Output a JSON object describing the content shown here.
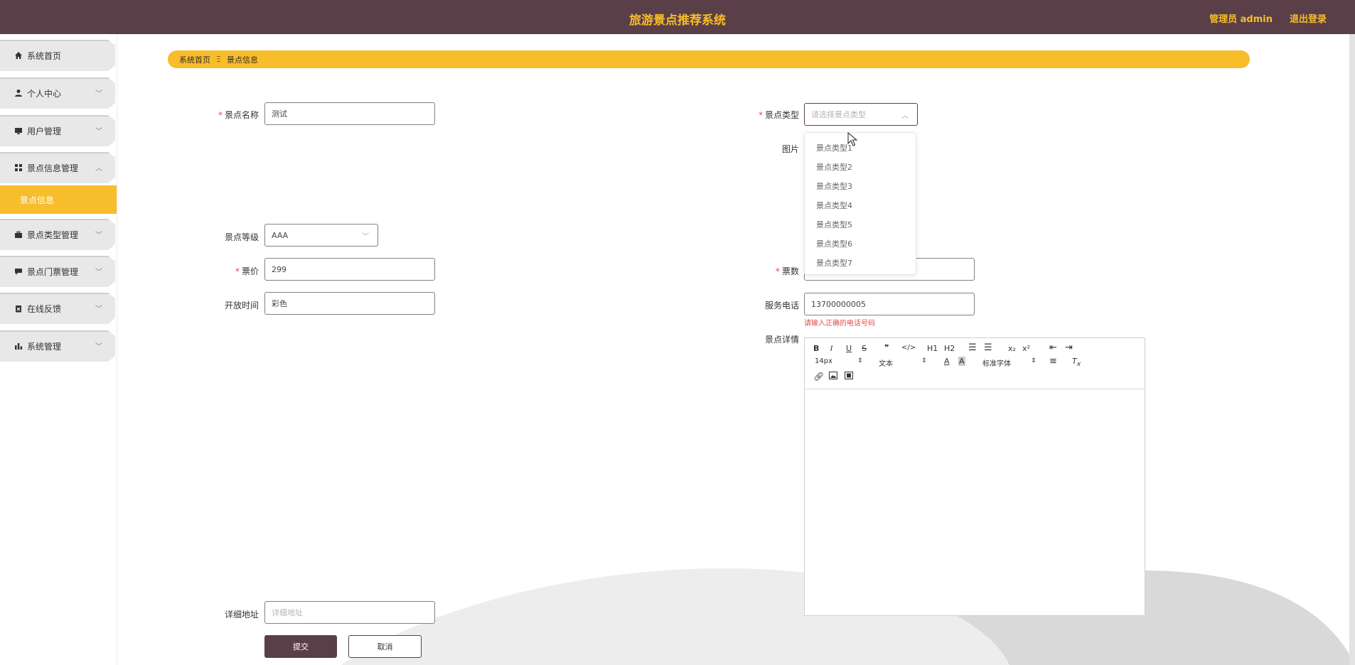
{
  "header": {
    "title": "旅游景点推荐系统",
    "user_label": "管理员 admin",
    "logout_label": "退出登录"
  },
  "sidebar": {
    "items": [
      {
        "label": "系统首页",
        "icon": "home-icon"
      },
      {
        "label": "个人中心",
        "icon": "person-icon"
      },
      {
        "label": "用户管理",
        "icon": "monitor-icon"
      },
      {
        "label": "景点信息管理",
        "icon": "grid-icon"
      },
      {
        "label": "景点类型管理",
        "icon": "briefcase-icon"
      },
      {
        "label": "景点门票管理",
        "icon": "chat-icon"
      },
      {
        "label": "在线反馈",
        "icon": "clipboard-icon"
      },
      {
        "label": "系统管理",
        "icon": "bar-chart-icon"
      }
    ],
    "active_sub": "景点信息"
  },
  "breadcrumb": {
    "home": "系统首页",
    "separator": "Ξ",
    "current": "景点信息"
  },
  "form": {
    "name_label": "景点名称",
    "name_value": "测试",
    "type_label": "景点类型",
    "type_placeholder": "请选择景点类型",
    "type_options": [
      "景点类型1",
      "景点类型2",
      "景点类型3",
      "景点类型4",
      "景点类型5",
      "景点类型6",
      "景点类型7"
    ],
    "image_label": "图片",
    "level_label": "景点等级",
    "level_value": "AAA",
    "price_label": "票价",
    "price_value": "299",
    "count_label": "票数",
    "open_label": "开放时间",
    "open_value": "彩色",
    "phone_label": "服务电话",
    "phone_value": "13700000005",
    "phone_error": "请输入正确的电话号码",
    "detail_label": "景点详情",
    "address_label": "详细地址",
    "address_placeholder": "详细地址",
    "submit_label": "提交",
    "cancel_label": "取消"
  },
  "editor": {
    "font_size": "14px",
    "block_format": "文本",
    "font_family": "标准字体",
    "h1": "H1",
    "h2": "H2",
    "sub": "x₂",
    "sup": "x²"
  },
  "colors": {
    "header_bg": "#5a3f48",
    "accent": "#f7bd2a",
    "error": "#e34b4b"
  }
}
